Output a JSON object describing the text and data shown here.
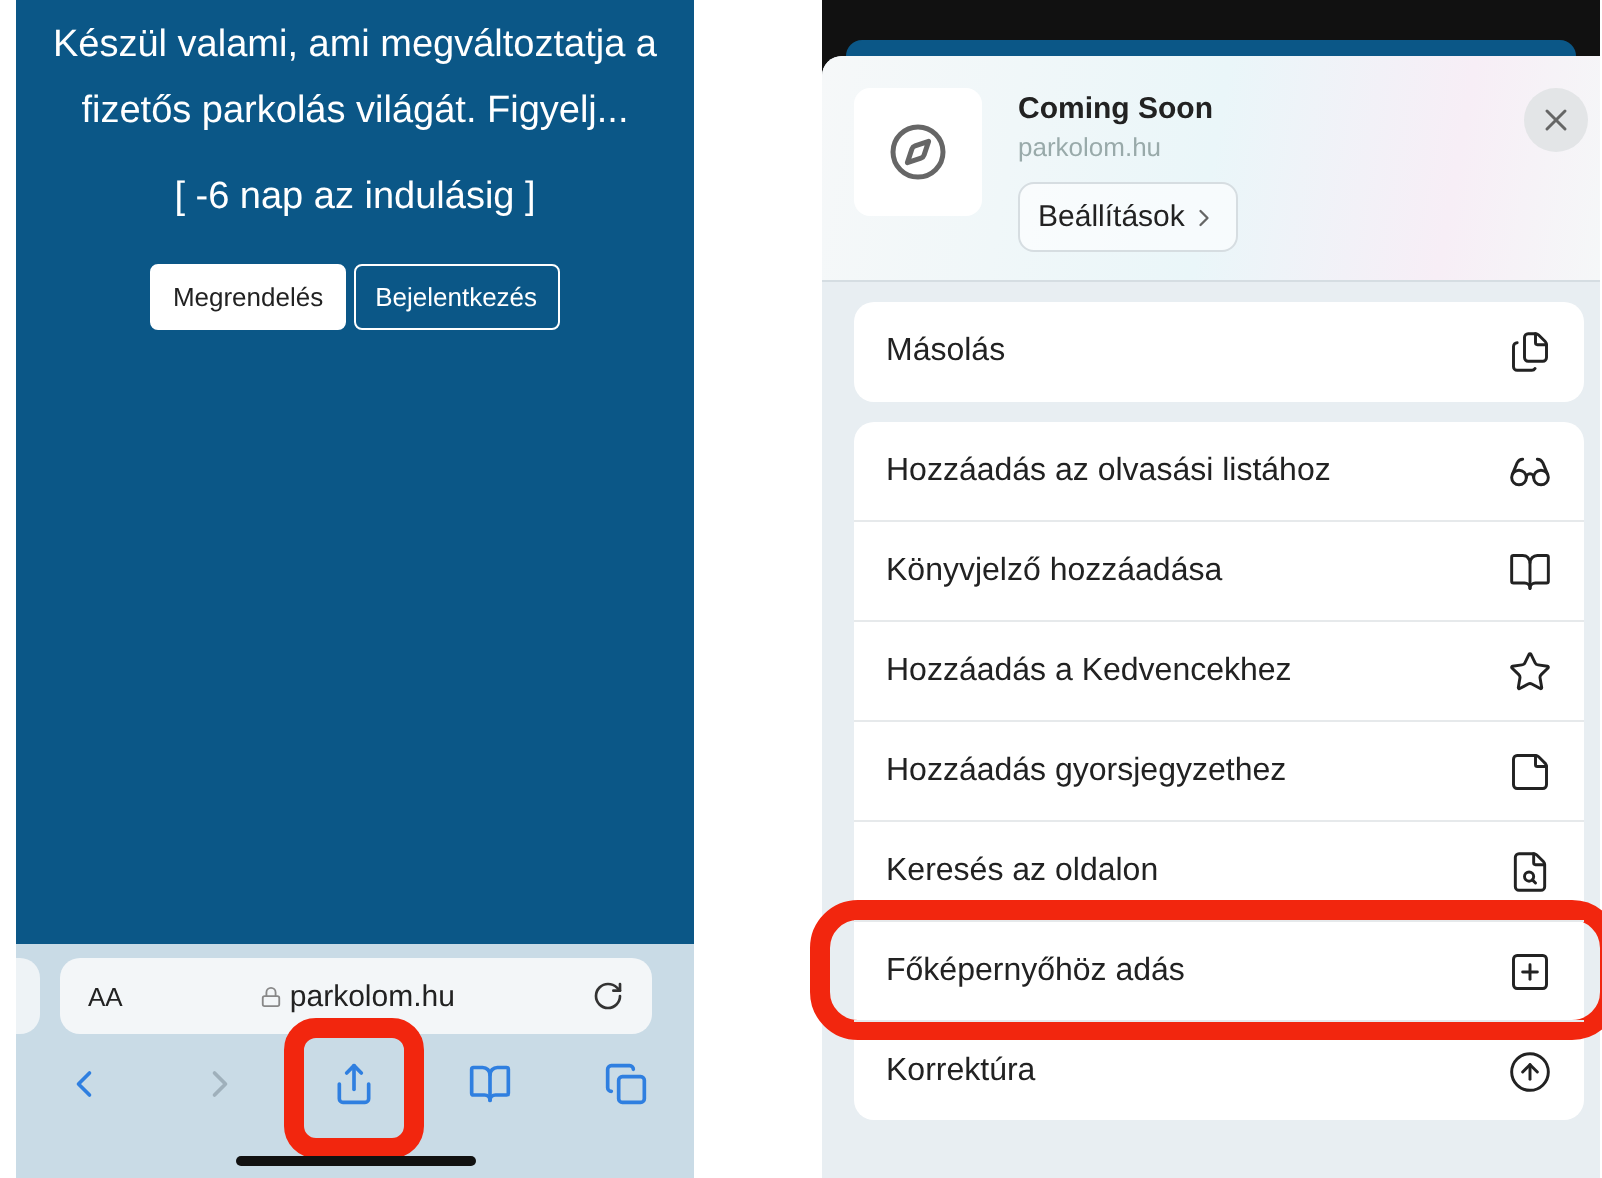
{
  "page_screen": {
    "message": "Készül valami, ami megváltoztatja a fizetős parkolás világát. Figyelj...",
    "countdown": "[ -6 nap az indulásig ]",
    "buttons": [
      {
        "label": "Megrendelés",
        "selected": true
      },
      {
        "label": "Bejelentkezés",
        "selected": false
      }
    ],
    "address_bar": {
      "text_size_button": "AA",
      "url": "parkolom.hu"
    },
    "toolbar": [
      {
        "kind": "back",
        "disabled": false,
        "highlighted": false
      },
      {
        "kind": "forward",
        "disabled": true,
        "highlighted": false
      },
      {
        "kind": "share",
        "disabled": false,
        "highlighted": true
      },
      {
        "kind": "bookmarks",
        "disabled": false,
        "highlighted": false
      },
      {
        "kind": "tabs",
        "disabled": false,
        "highlighted": false
      }
    ]
  },
  "share_sheet": {
    "site": {
      "title": "Coming Soon",
      "domain": "parkolom.hu",
      "settings_button": "Beállítások"
    },
    "action_groups": [
      [
        {
          "label": "Másolás",
          "kind": "copy",
          "highlighted": false
        }
      ],
      [
        {
          "label": "Hozzáadás az olvasási listához",
          "kind": "reading-list",
          "highlighted": false
        },
        {
          "label": "Könyvjelző hozzáadása",
          "kind": "bookmark",
          "highlighted": false
        },
        {
          "label": "Hozzáadás a Kedvencekhez",
          "kind": "favorite",
          "highlighted": false
        },
        {
          "label": "Hozzáadás gyorsjegyzethez",
          "kind": "quick-note",
          "highlighted": false
        },
        {
          "label": "Keresés az oldalon",
          "kind": "find",
          "highlighted": false
        },
        {
          "label": "Főképernyőhöz adás",
          "kind": "home-screen",
          "highlighted": true
        },
        {
          "label": "Korrektúra",
          "kind": "markup",
          "highlighted": false
        }
      ]
    ]
  }
}
